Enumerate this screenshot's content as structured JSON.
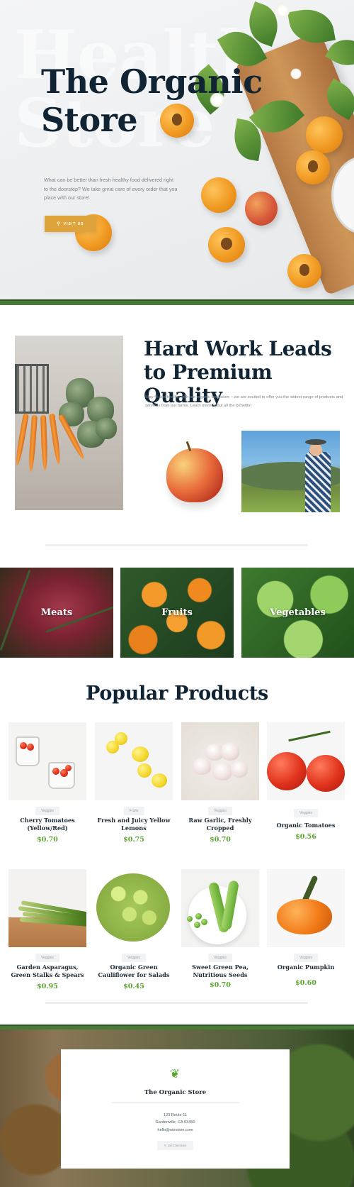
{
  "hero": {
    "watermark_line1": "Health",
    "watermark_line2": "Store",
    "title_line1": "The Organic",
    "title_line2": "Store",
    "description": "What can be better than fresh healthy food delivered right to the doorstep? We take great care of every order that you place with our store!",
    "button_label": "VISIT US",
    "button_icon": "map-pin-icon",
    "accent_color": "#dea33a"
  },
  "about": {
    "title": "Hard Work Leads to Premium Quality",
    "description": "Stay fit and healthy with our organic food store – we are excited to offer you the widest range of products and services from our farms. Learn more about all the benefits!"
  },
  "categories": [
    {
      "label": "Meats"
    },
    {
      "label": "Fruits"
    },
    {
      "label": "Vegetables"
    }
  ],
  "products": {
    "title": "Popular Products",
    "price_color": "#5aa52d",
    "items": [
      {
        "tag": "Veggies",
        "name": "Cherry Tomatoes (Yellow/Red)",
        "price": "$0.70"
      },
      {
        "tag": "Fruits",
        "name": "Fresh and Juicy Yellow Lemons",
        "price": "$0.75"
      },
      {
        "tag": "Veggies",
        "name": "Raw Garlic, Freshly Cropped",
        "price": "$0.70"
      },
      {
        "tag": "Veggies",
        "name": "Organic Tomatoes",
        "price": "$0.56"
      },
      {
        "tag": "Veggies",
        "name": "Garden Asparagus, Green Stalks & Spears",
        "price": "$0.95"
      },
      {
        "tag": "Veggies",
        "name": "Organic Green Cauliflower for Salads",
        "price": "$0.45"
      },
      {
        "tag": "Veggies",
        "name": "Sweet Green Pea, Nutritious Seeds",
        "price": "$0.70"
      },
      {
        "tag": "Veggies",
        "name": "Organic Pumpkin",
        "price": "$0.60"
      }
    ]
  },
  "footer": {
    "logo_icon": "vegetable-basket-icon",
    "name": "The Organic Store",
    "address_line1": "123 Route 11",
    "address_line2": "Gardenville, CA 93450",
    "email": "hello@ourstore.com",
    "button_label": "Get Directions",
    "button_icon": "map-pin-icon",
    "band_color": "#4a7a3a"
  }
}
